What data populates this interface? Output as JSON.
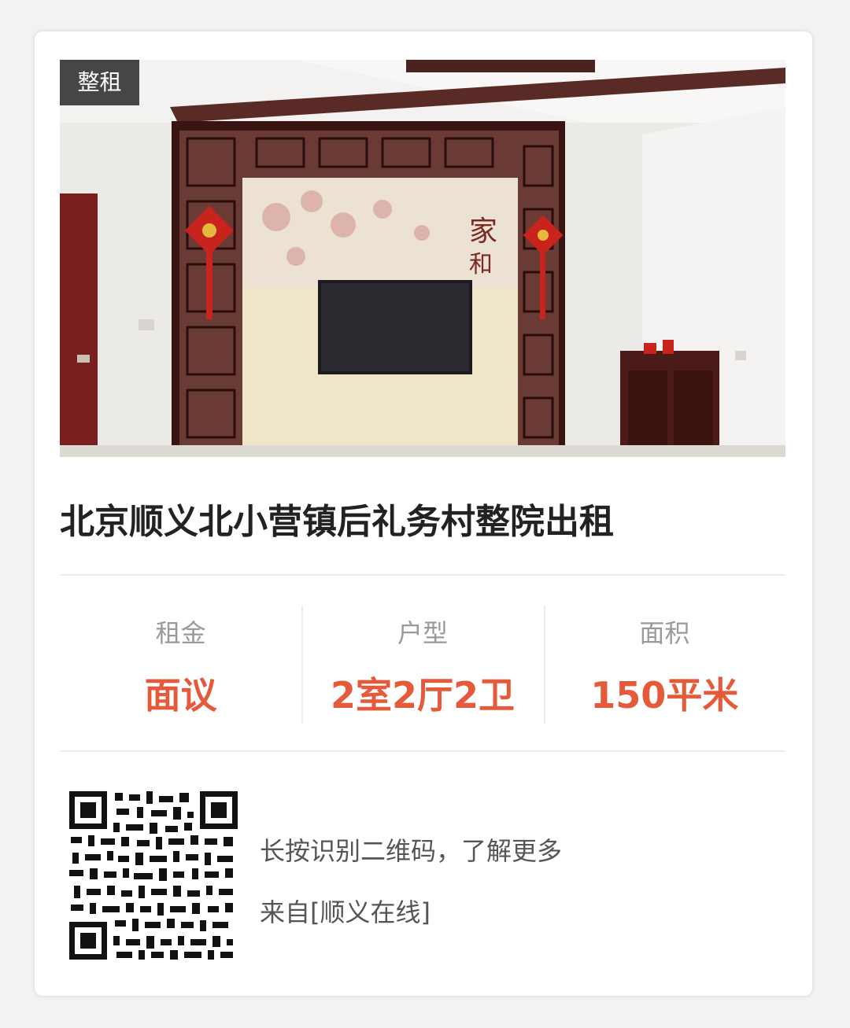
{
  "listing": {
    "tag": "整租",
    "title": "北京顺义北小营镇后礼务村整院出租",
    "photo_icon": "living-room-photo"
  },
  "stats": [
    {
      "label": "租金",
      "value": "面议"
    },
    {
      "label": "户型",
      "value": "2室2厅2卫"
    },
    {
      "label": "面积",
      "value": "150平米"
    }
  ],
  "footer": {
    "qr_icon": "qr-code-icon",
    "hint": "长按识别二维码，了解更多",
    "source": "来自[顺义在线]"
  },
  "colors": {
    "accent": "#e65a3c",
    "label": "#9a9a9a",
    "title": "#222222"
  }
}
